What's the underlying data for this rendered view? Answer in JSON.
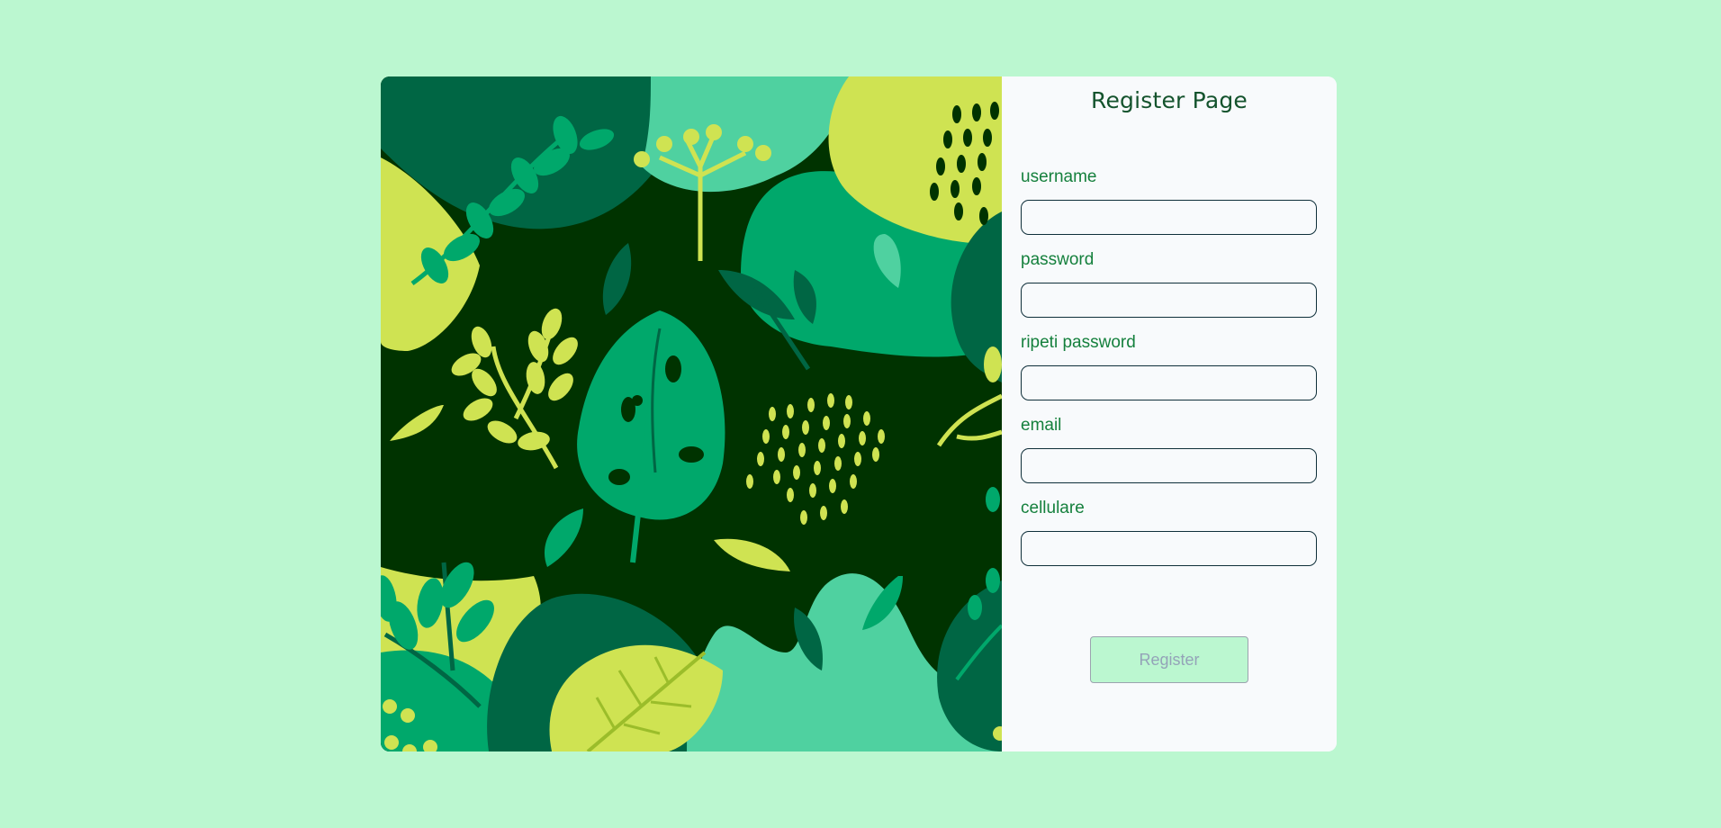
{
  "page": {
    "title": "Register Page"
  },
  "form": {
    "fields": [
      {
        "label": "username",
        "value": ""
      },
      {
        "label": "password",
        "value": ""
      },
      {
        "label": "ripeti password",
        "value": ""
      },
      {
        "label": "email",
        "value": ""
      },
      {
        "label": "cellulare",
        "value": ""
      }
    ],
    "submit_label": "Register"
  },
  "colors": {
    "background": "#bbf7d0",
    "panel": "#f8fafc",
    "title": "#14532d",
    "label": "#15803d",
    "input_border": "#0f2f3a",
    "button_bg": "#bbf7d0",
    "button_text": "#94a3b8"
  },
  "icons": {
    "art": "tropical-leaves-illustration"
  }
}
